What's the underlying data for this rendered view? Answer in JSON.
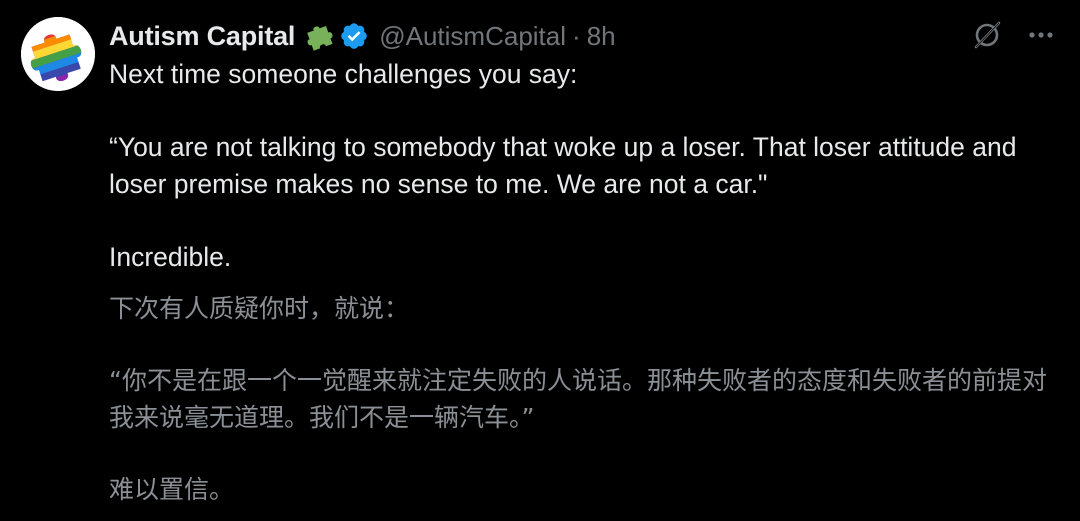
{
  "author": {
    "display_name": "Autism Capital",
    "handle": "@AutismCapital",
    "separator": "·",
    "timestamp": "8h",
    "badges": [
      "puzzle-piece-icon",
      "verified-icon"
    ],
    "avatar_icon": "rainbow-puzzle-avatar"
  },
  "actions": {
    "grok_icon": "grok-icon",
    "more_icon": "more-icon"
  },
  "tweet": {
    "line1": "Next time someone challenges you say:",
    "quote": "“You are not talking to somebody that woke up a loser. That loser attitude and loser premise makes no sense to me. We are not a car.\"",
    "closing": "Incredible."
  },
  "translation": {
    "line1": "下次有人质疑你时，就说：",
    "quote": "“你不是在跟一个一觉醒来就注定失败的人说话。那种失败者的态度和失败者的前提对我来说毫无道理。我们不是一辆汽车。”",
    "closing": "难以置信。"
  },
  "colors": {
    "background": "#000000",
    "primary_text": "#e7e9ea",
    "secondary_text": "#71767b",
    "verified_blue": "#1d9bf0",
    "puzzle_green": "#78b159"
  }
}
